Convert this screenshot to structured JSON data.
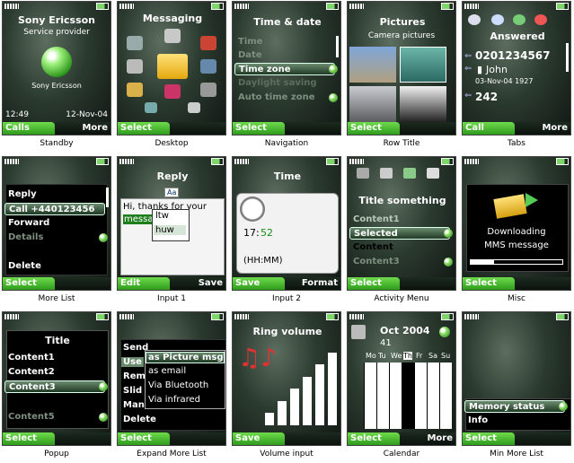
{
  "standby": {
    "caption": "Standby",
    "brand": "Sony Ericsson",
    "provider": "Service provider",
    "logo_text": "Sony Ericsson",
    "time": "12:49",
    "date": "12-Nov-04",
    "left": "Calls",
    "right": "More"
  },
  "desktop": {
    "caption": "Desktop",
    "title": "Messaging",
    "left": "Select"
  },
  "navigation": {
    "caption": "Navigation",
    "title": "Time & date",
    "items": [
      "Time",
      "Date",
      "Time zone",
      "Daylight saving",
      "Auto time zone"
    ],
    "left": "Select"
  },
  "rowtitle": {
    "caption": "Row Title",
    "title": "Pictures",
    "subtitle": "Camera pictures",
    "left": "Select"
  },
  "tabs": {
    "caption": "Tabs",
    "title": "Answered",
    "number": "0201234567",
    "name": "John",
    "datetime": "03-Nov-04 1927",
    "count": "242",
    "left": "Call",
    "right": "More"
  },
  "morelist": {
    "caption": "More List",
    "items": [
      "Reply",
      "Call +440123456",
      "Forward",
      "Details",
      "Delete"
    ],
    "left": "Select"
  },
  "input1": {
    "caption": "Input 1",
    "title": "Reply",
    "mode": "Aa",
    "text": "Hi, thanks for your",
    "word": "messa",
    "suggestions": [
      "ltw",
      "huw"
    ],
    "left": "Edit",
    "right": "Save"
  },
  "input2": {
    "caption": "Input 2",
    "title": "Time",
    "time_h": "17:",
    "time_m": "52",
    "format": "(HH:MM)",
    "left": "Save",
    "right": "Format"
  },
  "activity": {
    "caption": "Activity Menu",
    "title": "Title something",
    "items": [
      "Content1",
      "Selected",
      "Content",
      "Content3"
    ],
    "left": "Select"
  },
  "misc": {
    "caption": "Misc",
    "line1": "Downloading",
    "line2": "MMS message",
    "left": "Select"
  },
  "popup": {
    "caption": "Popup",
    "title": "Title",
    "items": [
      "Content1",
      "Content2",
      "Content3",
      "Content5"
    ],
    "left": "Select"
  },
  "expand": {
    "caption": "Expand More List",
    "back_items": [
      "Send",
      "Use",
      "Rem",
      "Slid",
      "Man",
      "Delete"
    ],
    "sub_items": [
      "as Picture msg",
      "as email",
      "Via Bluetooth",
      "Via infrared"
    ],
    "left": "Select"
  },
  "volume": {
    "caption": "Volume input",
    "title": "Ring volume",
    "levels": [
      0.15,
      0.3,
      0.45,
      0.6,
      0.75,
      0.9
    ],
    "left": "Save"
  },
  "calendar": {
    "caption": "Calendar",
    "month": "Oct 2004",
    "week": "41",
    "days": [
      "Mo",
      "Tu",
      "We",
      "Th",
      "Fr",
      "Sa",
      "Su"
    ],
    "left": "Select",
    "right": "More"
  },
  "minmore": {
    "caption": "Min More List",
    "items": [
      "Memory status",
      "Info"
    ],
    "left": "Select"
  }
}
